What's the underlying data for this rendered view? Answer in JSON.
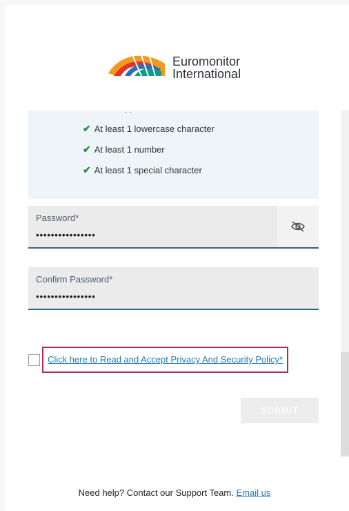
{
  "brand": {
    "line1": "Euromonitor",
    "line2": "International"
  },
  "requirements": {
    "items": [
      "At least 1 lowercase character",
      "At least 1 number",
      "At least 1 special character"
    ],
    "check_color": "#2b8a3e"
  },
  "password": {
    "label": "Password*",
    "value": "••••••••••••••••"
  },
  "confirm_password": {
    "label": "Confirm Password*",
    "value": "••••••••••••••••"
  },
  "policy": {
    "link_text": "Click here to Read and Accept Privacy And Security Policy*",
    "checked": false
  },
  "submit": {
    "label": "SUBMIT"
  },
  "help": {
    "text": "Need help? Contact our Support Team.",
    "link": "Email us"
  },
  "colors": {
    "accent": "#1f79bd",
    "highlight_border": "#b5265a",
    "field_underline": "#3a5f7d"
  }
}
